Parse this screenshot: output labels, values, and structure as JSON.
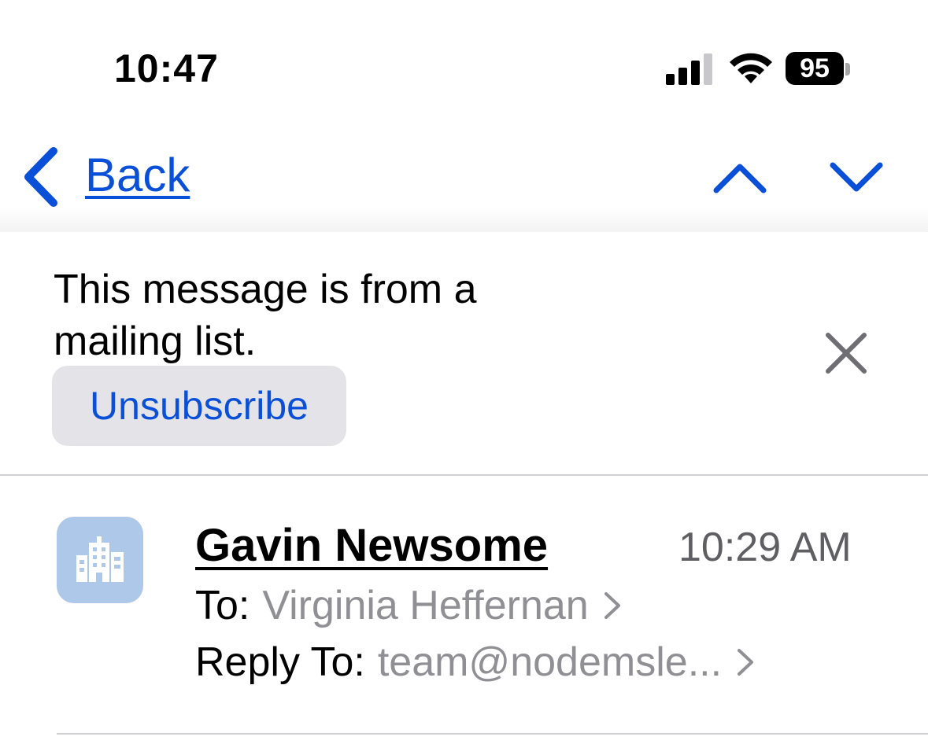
{
  "status_bar": {
    "time": "10:47",
    "battery_level": "95",
    "icons": [
      "signal-icon",
      "wifi-icon",
      "battery-icon"
    ]
  },
  "nav": {
    "back_label": "Back",
    "icons": [
      "back-chevron-icon",
      "previous-message-icon",
      "next-message-icon"
    ]
  },
  "banner": {
    "message": "This message is from a mailing list.",
    "unsubscribe_label": "Unsubscribe",
    "close_icon": "close-icon"
  },
  "message": {
    "sender": "Gavin Newsome",
    "time": "10:29 AM",
    "to_label": "To:",
    "to_value": "Virginia Heffernan",
    "reply_to_label": "Reply To:",
    "reply_to_value": "team@nodemsle...",
    "avatar_icon": "building-icon"
  },
  "colors": {
    "accent": "#0a4fd8",
    "secondary_text": "#8f8f94",
    "time_text": "#5f5f63",
    "button_bg": "#e3e3e8",
    "avatar_bg": "#adc8e8"
  }
}
